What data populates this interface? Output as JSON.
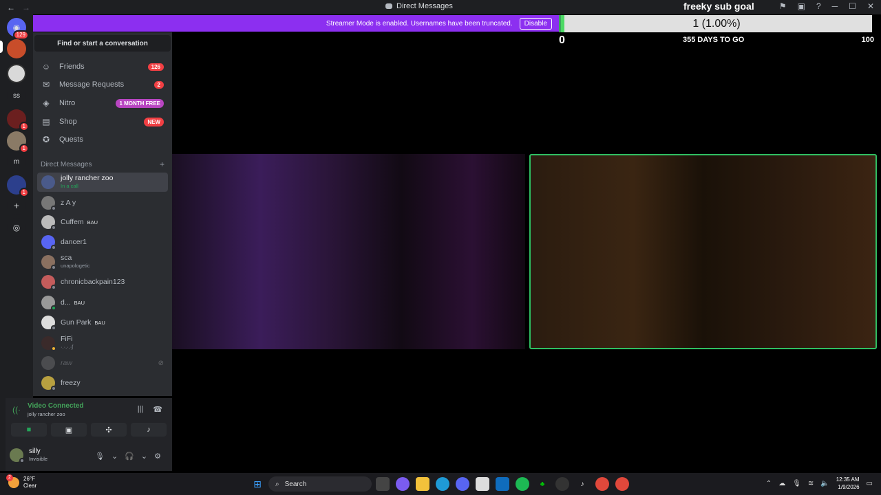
{
  "titlebar": {
    "title": "Direct Messages"
  },
  "goal": {
    "title": "freeky sub goal",
    "progress_text": "1 (1.00%)",
    "progress": 0.01,
    "min": "0",
    "max": "100",
    "days_left": "355 DAYS TO GO"
  },
  "streamer": {
    "message": "Streamer Mode is enabled. Usernames have been truncated.",
    "disable_label": "Disable"
  },
  "rail": {
    "home_badge": "129",
    "ss_label": "ss",
    "m_label": "m",
    "badge_1": "1",
    "badge_2": "1",
    "badge_3": "1"
  },
  "sidebar": {
    "find_label": "Find or start a conversation",
    "nav": [
      {
        "label": "Friends",
        "count": "126"
      },
      {
        "label": "Message Requests",
        "count": "2"
      },
      {
        "label": "Nitro",
        "tag": "1 MONTH FREE"
      },
      {
        "label": "Shop",
        "tag": "NEW"
      },
      {
        "label": "Quests"
      }
    ],
    "dm_header": "Direct Messages",
    "dms": [
      {
        "name": "jolly rancher zoo",
        "sub": "In a call"
      },
      {
        "name": "z A y",
        "sub": ""
      },
      {
        "name": "Cuffem",
        "tag": "BAU"
      },
      {
        "name": "dancer1",
        "sub": ""
      },
      {
        "name": "sca",
        "sub": "unapologetic"
      },
      {
        "name": "chronicbackpain123",
        "sub": ""
      },
      {
        "name": "d...",
        "tag": "BAU"
      },
      {
        "name": "Gun Park",
        "tag": "BAU"
      },
      {
        "name": "FiFi",
        "sub": "·.·.·.·ʃ"
      },
      {
        "name": "raw",
        "sub": ""
      },
      {
        "name": "freezy",
        "sub": ""
      }
    ]
  },
  "voice": {
    "status": "Video Connected",
    "channel": "jolly rancher zoo",
    "user_name": "silly",
    "user_status": "Invisible"
  },
  "taskbar": {
    "temp": "26°F",
    "weather": "Clear",
    "search_label": "Search",
    "time": "12:35 AM",
    "date": "1/9/2026",
    "weather_badge": "2"
  },
  "colors": {
    "accent": "#8c2ff0",
    "connected": "#43a25a",
    "badge": "#f23f43",
    "goal_fill": "#4cd964"
  }
}
